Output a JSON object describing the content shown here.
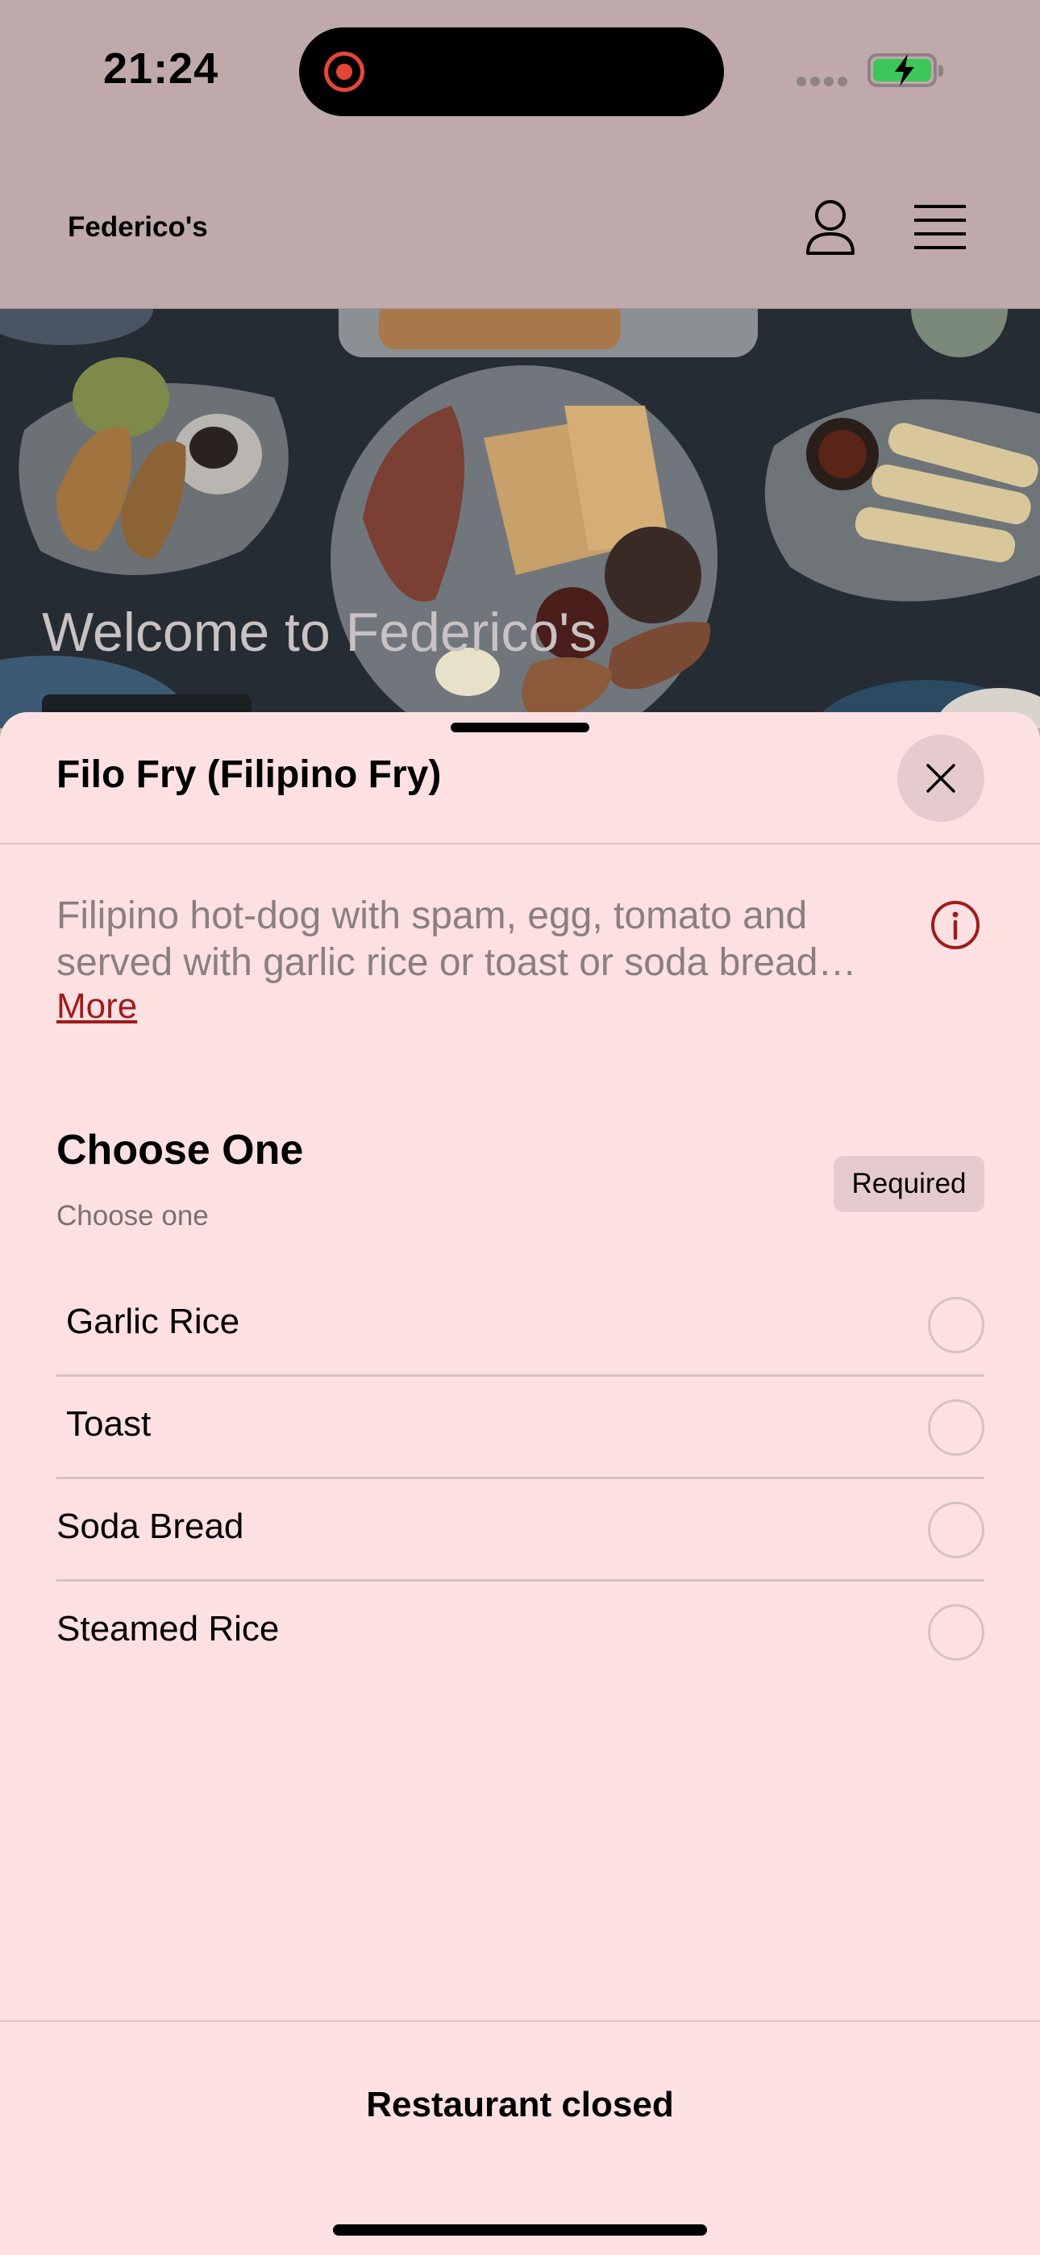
{
  "status_bar": {
    "time": "21:24",
    "icons": [
      "screen-recording-icon",
      "cellular-signal-icon",
      "battery-charging-icon"
    ],
    "battery_color": "#3dc75a"
  },
  "header": {
    "brand": "Federico's",
    "icons": [
      "user-icon",
      "menu-icon"
    ]
  },
  "hero": {
    "title": "Welcome to Federico's"
  },
  "item_sheet": {
    "title": "Filo Fry (Filipino Fry)",
    "description_line_1": "Filipino hot-dog with spam, egg, tomato and",
    "description_line_2": "served with garlic rice or toast or soda bread…",
    "more_label": "More",
    "info_icon": "info-icon",
    "close_icon": "close-icon",
    "accent_color": "#9e1c1c",
    "option_group": {
      "title": "Choose One",
      "subtitle": "Choose one",
      "badge": "Required",
      "options": [
        {
          "label": "Garlic Rice",
          "selected": false
        },
        {
          "label": "Toast",
          "selected": false
        },
        {
          "label": "Soda Bread",
          "selected": false
        },
        {
          "label": "Steamed Rice",
          "selected": false
        }
      ]
    },
    "footer_status": "Restaurant closed"
  }
}
